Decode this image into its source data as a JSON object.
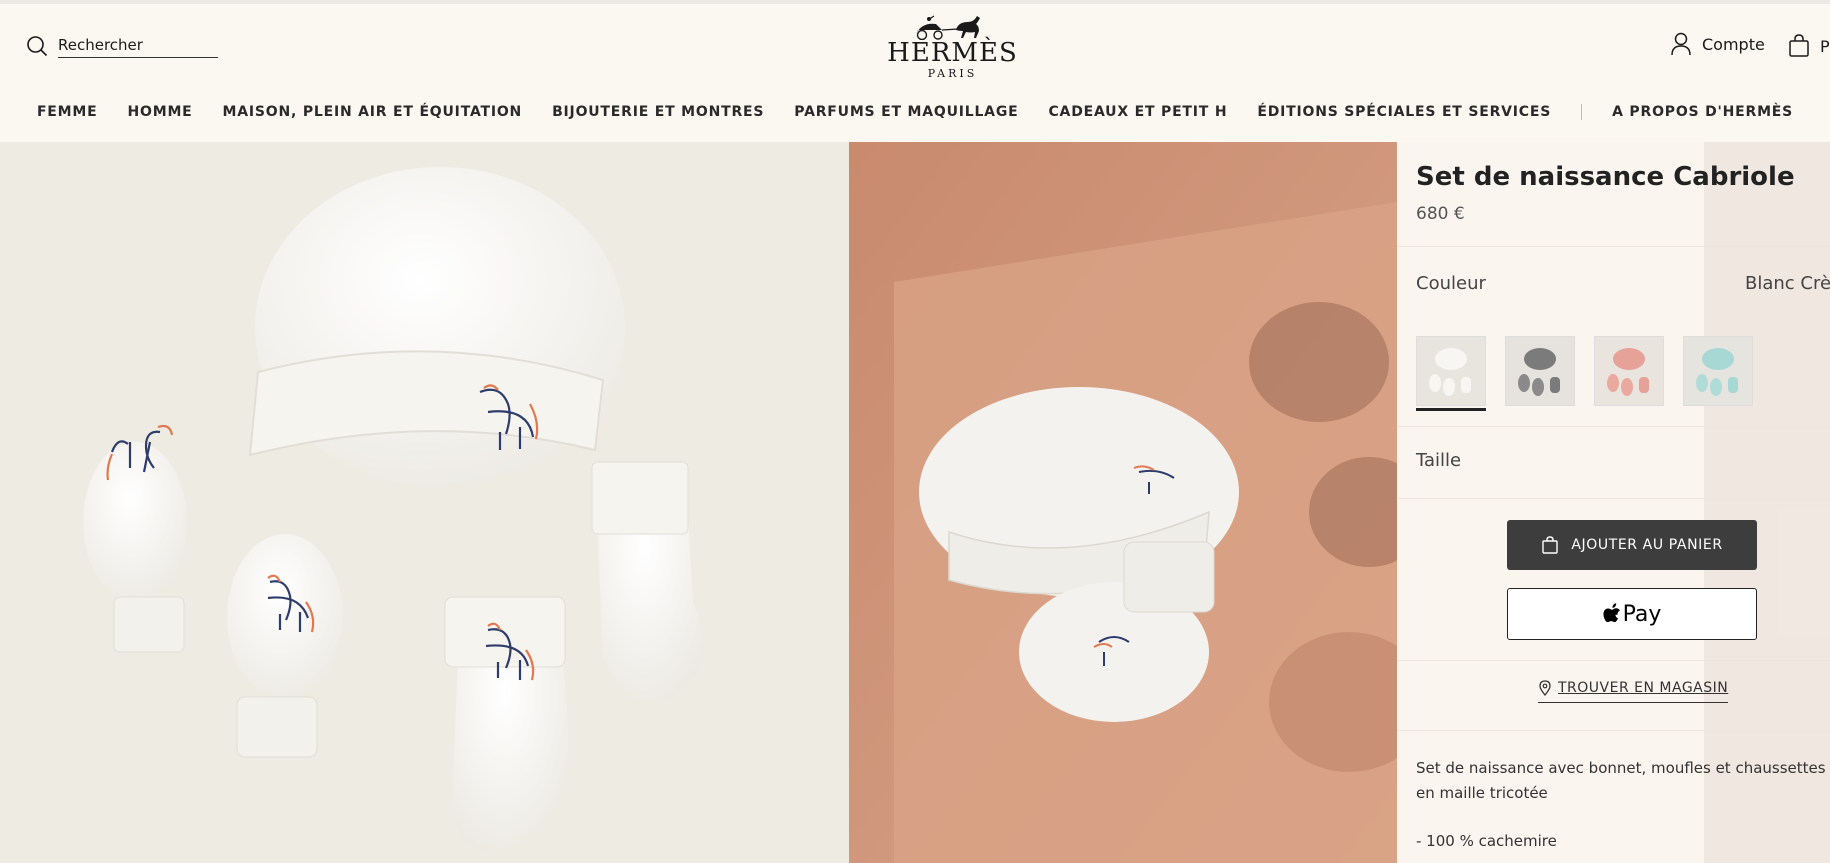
{
  "header": {
    "search_placeholder": "Rechercher",
    "logo": {
      "name": "HERMÈS",
      "city": "PARIS"
    },
    "account_label": "Compte",
    "cart_label": "P"
  },
  "nav": {
    "items": [
      "FEMME",
      "HOMME",
      "MAISON, PLEIN AIR ET ÉQUITATION",
      "BIJOUTERIE ET MONTRES",
      "PARFUMS ET MAQUILLAGE",
      "CADEAUX ET PETIT H",
      "ÉDITIONS SPÉCIALES ET SERVICES"
    ],
    "about": "A PROPOS D'HERMÈS"
  },
  "product": {
    "title": "Set de naissance Cabriole",
    "price": "680 €",
    "color_label": "Couleur",
    "color_value": "Blanc Crème",
    "swatches": [
      {
        "name": "blanc-creme",
        "color": "#f1efe9",
        "selected": true
      },
      {
        "name": "gris",
        "color": "#858585",
        "selected": false
      },
      {
        "name": "rose",
        "color": "#e8a79e",
        "selected": false
      },
      {
        "name": "bleu",
        "color": "#a8d8d4",
        "selected": false
      }
    ],
    "size_label": "Taille",
    "add_to_cart": "AJOUTER AU PANIER",
    "apple_pay": "Pay",
    "store_locator": "TROUVER EN MAGASIN",
    "description": "Set de naissance avec bonnet, moufles et chaussettes en maille tricotée",
    "spec": "- 100 % cachemire"
  },
  "colors": {
    "background": "#fbf7f1",
    "panel": "#fbf5f0",
    "photo_left": "#eeebe3",
    "photo_right": "#c99075",
    "button_dark": "#3d3d3d",
    "embroidery_orange": "#e07850",
    "embroidery_navy": "#2d3c6b"
  },
  "icons": [
    "search-icon",
    "hermes-carriage-logo",
    "account-icon",
    "bag-icon",
    "apple-logo-icon",
    "location-pin-icon"
  ]
}
